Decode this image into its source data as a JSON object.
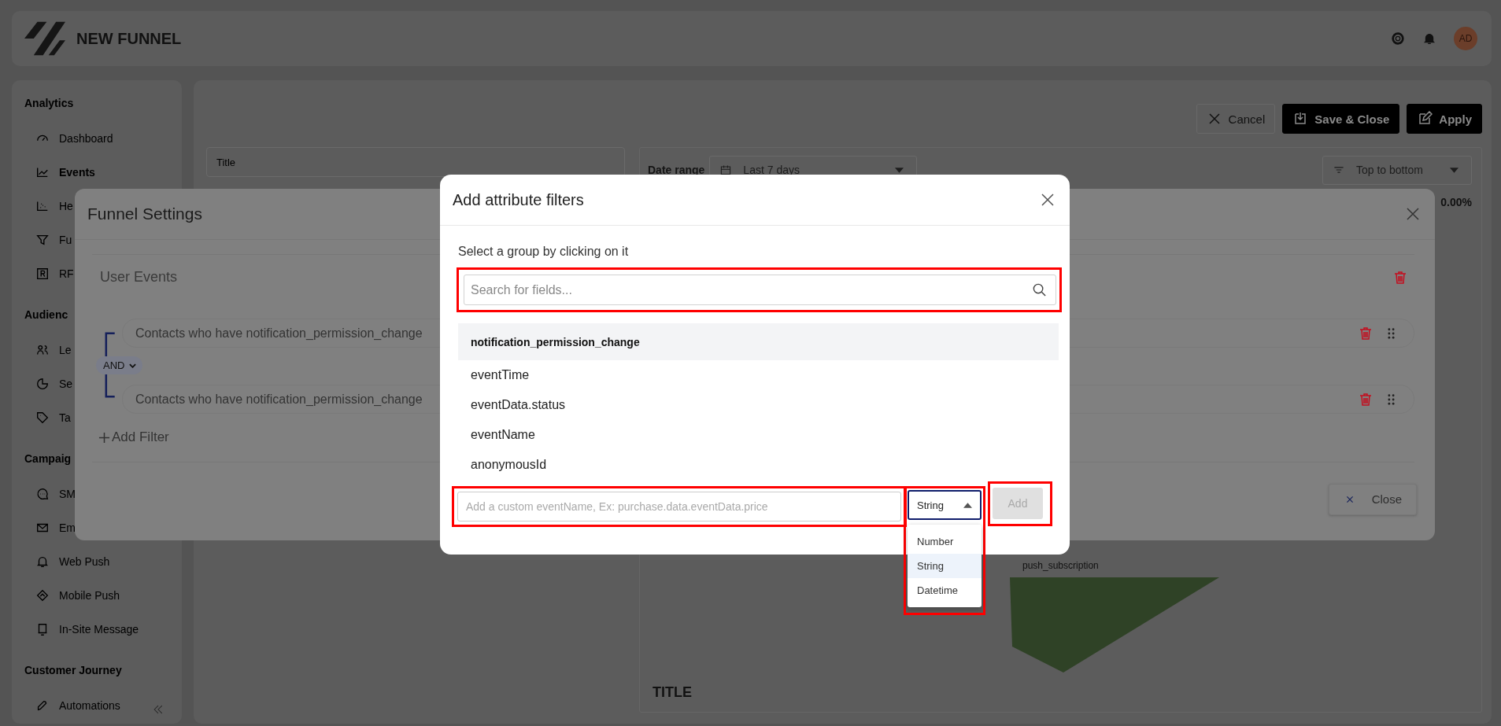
{
  "header": {
    "title": "NEW FUNNEL",
    "avatar": "AD"
  },
  "sidebar": {
    "sections": [
      {
        "title": "Analytics",
        "items": [
          {
            "label": "Dashboard",
            "selected": false
          },
          {
            "label": "Events",
            "selected": true
          },
          {
            "label": "He",
            "selected": false
          },
          {
            "label": "Fu",
            "selected": false
          },
          {
            "label": "RF",
            "selected": false
          }
        ]
      },
      {
        "title": "Audienc",
        "items": [
          {
            "label": "Le",
            "selected": false
          },
          {
            "label": "Se",
            "selected": false
          },
          {
            "label": "Ta",
            "selected": false
          }
        ]
      },
      {
        "title": "Campaig",
        "items": [
          {
            "label": "SM",
            "selected": false
          },
          {
            "label": "Em",
            "selected": false
          },
          {
            "label": "Web Push",
            "selected": false
          },
          {
            "label": "Mobile Push",
            "selected": false
          },
          {
            "label": "In-Site Message",
            "selected": false
          }
        ]
      },
      {
        "title": "Customer Journey",
        "items": [
          {
            "label": "Automations",
            "selected": false
          }
        ]
      }
    ]
  },
  "toolbar": {
    "buttons": [
      {
        "label": "Cancel",
        "kind": "outline"
      },
      {
        "label": "Save & Close",
        "kind": "primary"
      },
      {
        "label": "Apply",
        "kind": "primary"
      }
    ]
  },
  "title_field": {
    "placeholder": "Title"
  },
  "report": {
    "date_range_label": "Date range",
    "date_range": "Last 7 days",
    "sort": "Top to bottom",
    "rate": "0.00%",
    "funnel_step_label": "push_subscription",
    "chart_title": "TITLE"
  },
  "funnel_settings": {
    "title": "Funnel Settings",
    "section_title": "User Events",
    "operator": "AND",
    "filters": [
      {
        "text": "Contacts who have notification_permission_change"
      },
      {
        "text": "Contacts who have notification_permission_change"
      }
    ],
    "add_filter": "Add Filter",
    "close_button": "Close"
  },
  "attribute_dialog": {
    "title": "Add attribute filters",
    "hint": "Select a group by clicking on it",
    "search": {
      "placeholder": "Search for fields..."
    },
    "groups": [
      {
        "name": "notification_permission_change",
        "fields": [
          "eventTime",
          "eventData.status",
          "eventName",
          "anonymousId"
        ]
      }
    ],
    "custom_field": {
      "placeholder": "Add a custom eventName, Ex: purchase.data.eventData.price"
    },
    "type_select": {
      "value": "String",
      "expanded": true,
      "options": [
        {
          "label": "Number",
          "selected": false
        },
        {
          "label": "String",
          "selected": true
        },
        {
          "label": "Datetime",
          "selected": false
        }
      ]
    },
    "add_button": {
      "label": "Add",
      "disabled": true
    }
  }
}
